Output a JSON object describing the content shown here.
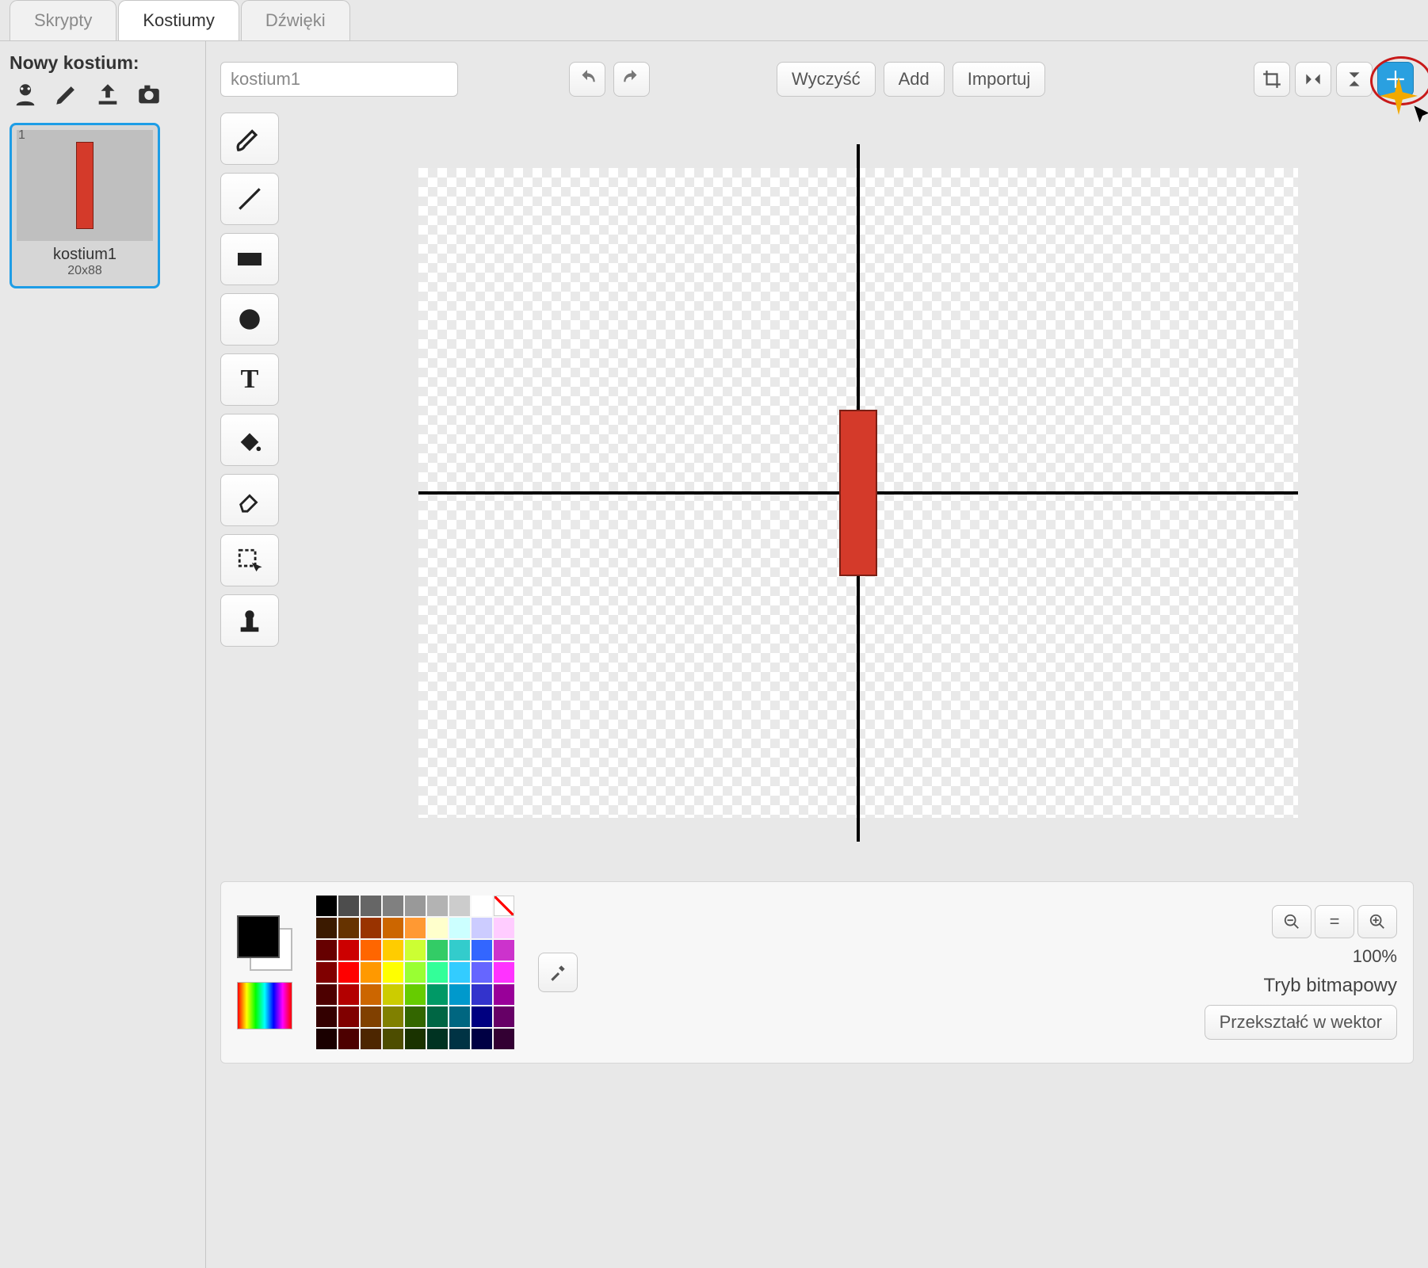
{
  "tabs": {
    "scripts": "Skrypty",
    "costumes": "Kostiumy",
    "sounds": "Dźwięki"
  },
  "sidebar": {
    "new_costume_label": "Nowy kostium:",
    "thumb": {
      "index": "1",
      "name": "kostium1",
      "size": "20x88"
    }
  },
  "toolbar": {
    "costume_name": "kostium1",
    "clear": "Wyczyść",
    "add": "Add",
    "import": "Importuj"
  },
  "tools": {
    "brush": "brush",
    "line": "line",
    "rect": "rectangle",
    "ellipse": "ellipse",
    "text": "text",
    "fill": "fill",
    "eraser": "eraser",
    "select": "select",
    "stamp": "stamp"
  },
  "footer": {
    "zoom_level": "100%",
    "mode_label": "Tryb bitmapowy",
    "convert_button": "Przekształć w wektor"
  },
  "palette_colors": [
    "#000000",
    "#4d4d4d",
    "#666666",
    "#808080",
    "#999999",
    "#b3b3b3",
    "#cccccc",
    "#ffffff",
    "NO",
    "#3b1a00",
    "#663300",
    "#993300",
    "#cc6600",
    "#ff9933",
    "#ffffcc",
    "#ccffff",
    "#ccccff",
    "#ffccff",
    "#660000",
    "#cc0000",
    "#ff6600",
    "#ffcc00",
    "#ccff33",
    "#33cc66",
    "#33cccc",
    "#3366ff",
    "#cc33cc",
    "#800000",
    "#ff0000",
    "#ff9900",
    "#ffff00",
    "#99ff33",
    "#33ff99",
    "#33ccff",
    "#6666ff",
    "#ff33ff",
    "#4d0000",
    "#b30000",
    "#cc6600",
    "#cccc00",
    "#66cc00",
    "#009966",
    "#0099cc",
    "#3333cc",
    "#990099",
    "#330000",
    "#800000",
    "#804000",
    "#808000",
    "#336600",
    "#006644",
    "#006680",
    "#000080",
    "#660066",
    "#1a0000",
    "#4d0000",
    "#4d2600",
    "#4d4d00",
    "#1a3300",
    "#003322",
    "#003344",
    "#000044",
    "#330033"
  ]
}
